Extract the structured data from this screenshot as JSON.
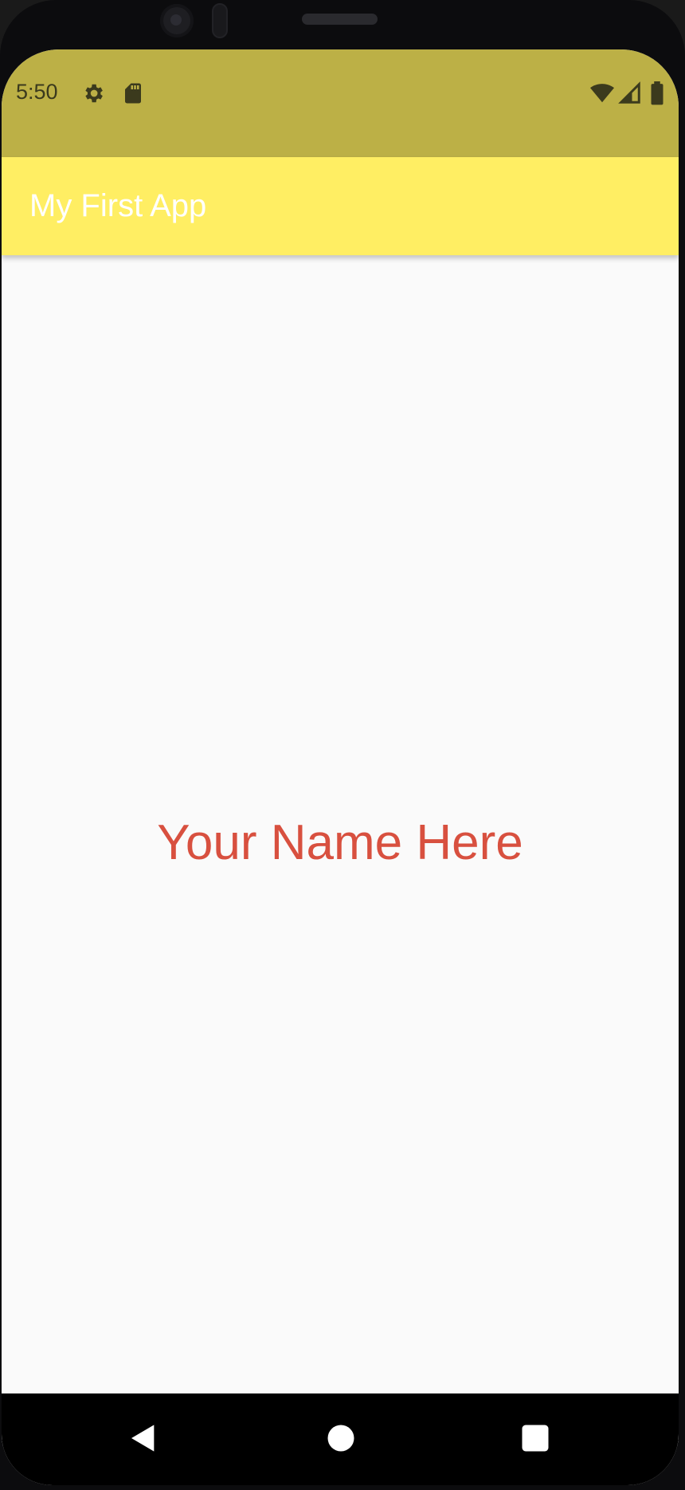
{
  "status_bar": {
    "time": "5:50",
    "left_icons": [
      "gear-icon",
      "sd-card-icon"
    ],
    "right_icons": [
      "wifi-icon",
      "cell-signal-icon",
      "battery-icon"
    ],
    "background_color": "#bcb046"
  },
  "app_bar": {
    "title": "My First App",
    "background_color": "#ffee63",
    "title_color": "#ffffff"
  },
  "main": {
    "name_text": "Your Name Here",
    "text_color": "#d8503f",
    "background_color": "#fafafa"
  },
  "nav_bar": {
    "buttons": [
      "back-icon",
      "home-icon",
      "recents-icon"
    ]
  }
}
